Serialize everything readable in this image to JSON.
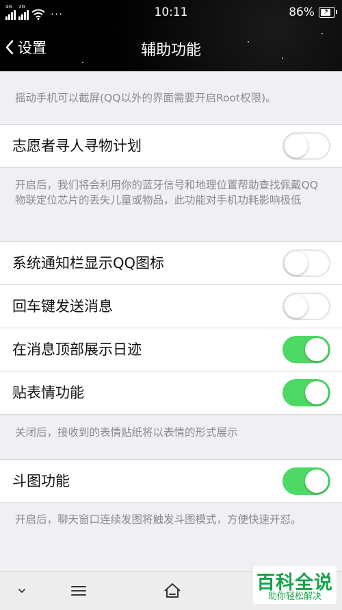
{
  "status_bar": {
    "network_1": "4G",
    "network_2": "2G",
    "more": "···",
    "time": "10:11",
    "battery": "86%"
  },
  "nav": {
    "back_label": "设置",
    "title": "辅助功能"
  },
  "notes": {
    "shake": "摇动手机可以截屏(QQ以外的界面需要开启Root权限)。",
    "volunteer": "开启后，我们将会利用你的蓝牙信号和地理位置帮助查找佩戴QQ物联定位芯片的丢失儿童或物品，此功能对手机功耗影响极低",
    "sticker": "关闭后，接收到的表情贴纸将以表情的形式展示",
    "doutu": "开启后，聊天窗口连续发图将触发斗图模式，方便快速开怼。"
  },
  "rows": [
    {
      "label": "志愿者寻人寻物计划",
      "on": false
    },
    {
      "label": "系统通知栏显示QQ图标",
      "on": false
    },
    {
      "label": "回车键发送消息",
      "on": false
    },
    {
      "label": "在消息顶部展示日迹",
      "on": true
    },
    {
      "label": "贴表情功能",
      "on": true
    },
    {
      "label": "斗图功能",
      "on": true
    }
  ],
  "colors": {
    "switch_on": "#4cd964",
    "switch_off_border": "#e3e3e6",
    "background": "#efeff4"
  },
  "watermark": {
    "main": "百科全说",
    "sub": "助你轻松解决"
  }
}
